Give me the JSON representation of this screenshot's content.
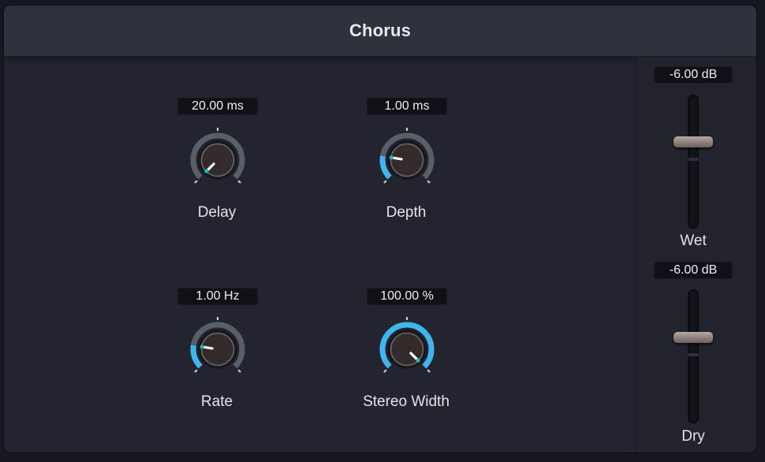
{
  "plugin": {
    "title": "Chorus"
  },
  "knobs": {
    "delay": {
      "label": "Delay",
      "value": "20.00 ms",
      "level": 0.0
    },
    "depth": {
      "label": "Depth",
      "value": "1.00 ms",
      "level": 0.2
    },
    "rate": {
      "label": "Rate",
      "value": "1.00 Hz",
      "level": 0.2
    },
    "width": {
      "label": "Stereo Width",
      "value": "100.00 %",
      "level": 1.0
    }
  },
  "faders": {
    "wet": {
      "label": "Wet",
      "value": "-6.00 dB"
    },
    "dry": {
      "label": "Dry",
      "value": "-6.00 dB"
    }
  },
  "colors": {
    "accent": "#3fb6ee",
    "knob_track": "#5a5e66",
    "background": "#22252f",
    "header": "#2d323d"
  }
}
